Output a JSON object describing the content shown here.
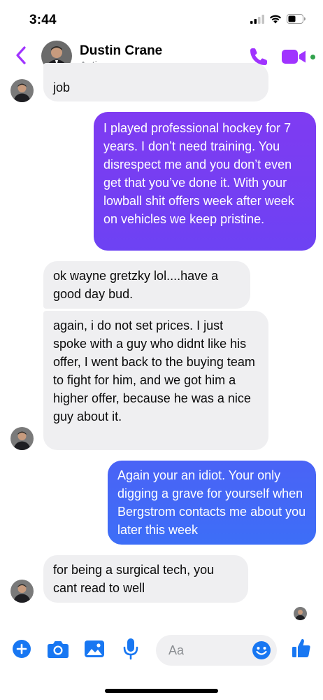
{
  "status_bar": {
    "time": "3:44",
    "icons": [
      "cellular-signal-icon",
      "wifi-icon",
      "battery-icon"
    ]
  },
  "header": {
    "contact_name": "Dustin Crane",
    "contact_status": "Active now",
    "accent_color": "#a033ff",
    "active_color": "#31a24c",
    "icons": [
      "chevron-left-icon",
      "phone-icon",
      "video-camera-icon"
    ]
  },
  "messages": [
    {
      "direction": "incoming",
      "text": "job"
    },
    {
      "direction": "outgoing",
      "text": "I played professional hockey for 7 years. I don’t need training. You disrespect me and you don’t even get that you’ve done it. With your lowball shit offers week after week on vehicles we keep pristine."
    },
    {
      "direction": "incoming",
      "text": "ok wayne gretzky lol....have a good day bud."
    },
    {
      "direction": "incoming",
      "text": "again, i do not set prices. I just spoke with a guy who didnt like his offer, I went back to the buying team to fight for him, and we got him a higher offer, because he was a nice guy about it."
    },
    {
      "direction": "outgoing",
      "text": "Again your an idiot. Your only digging a grave for yourself when Bergstrom contacts me about you later this week"
    },
    {
      "direction": "incoming",
      "text": "for being a surgical tech, you cant read to well"
    }
  ],
  "colors": {
    "incoming_bubble": "#efeff1",
    "outgoing_top": "#7f3bf2",
    "outgoing_bottom": "#3d6ef7",
    "composer_icon": "#1877f2"
  },
  "composer": {
    "placeholder": "Aa",
    "icons": [
      "plus-icon",
      "camera-icon",
      "image-icon",
      "microphone-icon",
      "emoji-icon",
      "thumbs-up-icon"
    ]
  }
}
